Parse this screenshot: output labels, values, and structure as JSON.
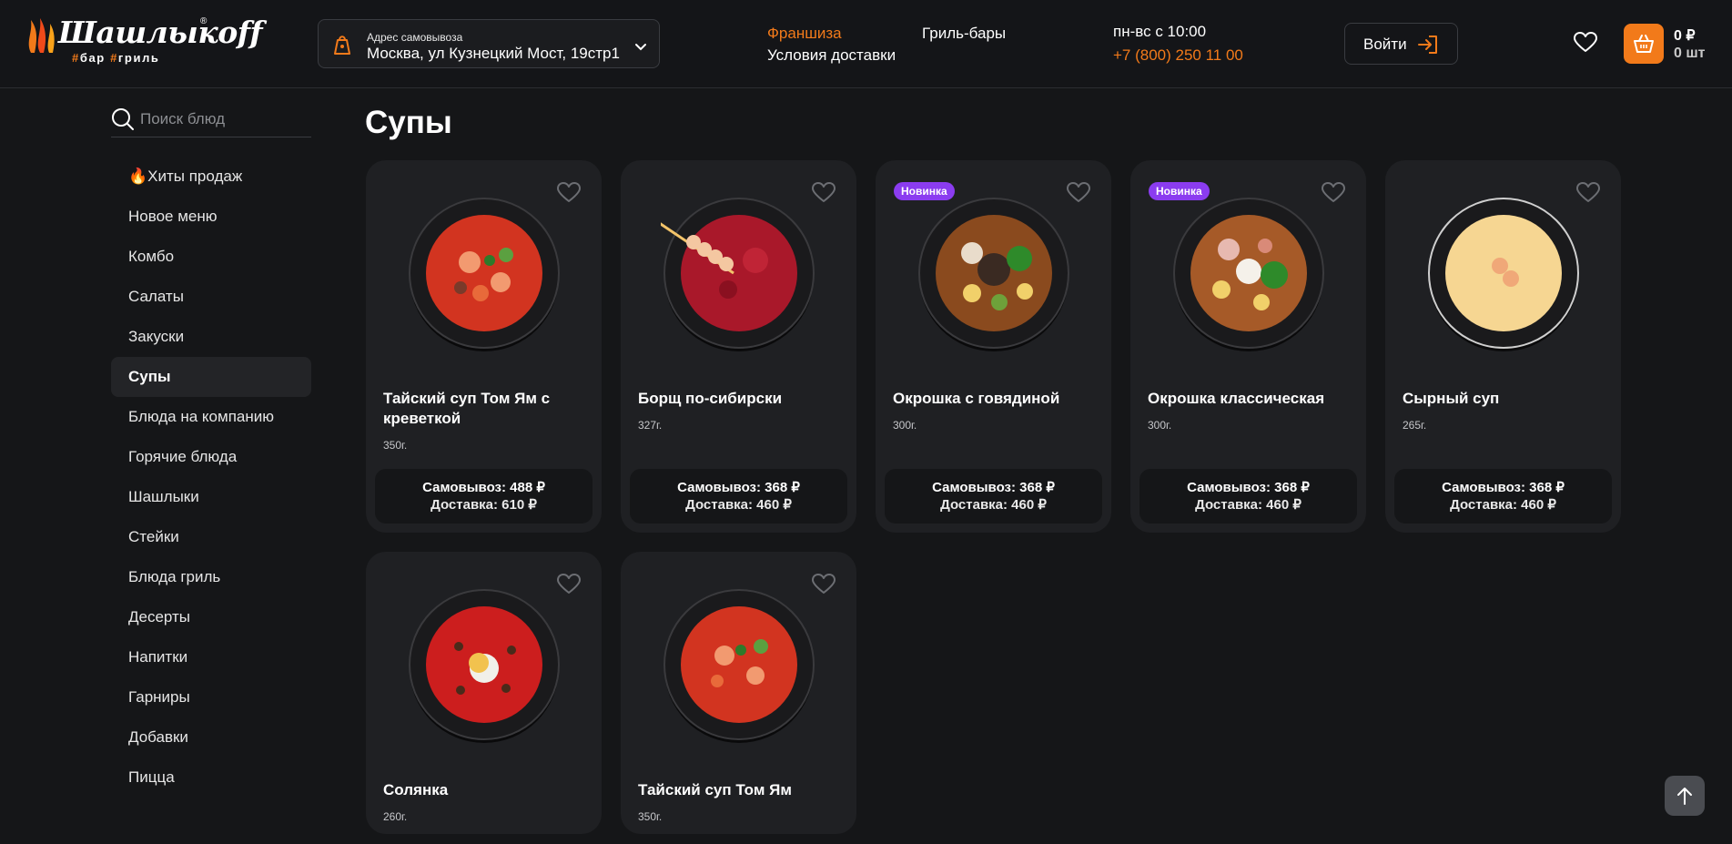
{
  "header": {
    "logo_text": "Шашлыкoff",
    "logo_sub_1": "бар",
    "logo_sub_2": "гриль",
    "address_label": "Адрес самовывоза",
    "address_value": "Москва, ул Кузнецкий Мост, 19стр1",
    "franchise": "Франшиза",
    "delivery_terms": "Условия доставки",
    "grill_bars": "Гриль-бары",
    "hours": "пн-вс с 10:00",
    "phone": "+7 (800) 250 11 00",
    "login": "Войти",
    "cart_sum": "0 ₽",
    "cart_count": "0 шт",
    "accent_color": "#f27a1a"
  },
  "sidebar": {
    "search_placeholder": "Поиск блюд",
    "items": [
      {
        "label": "🔥Хиты продаж"
      },
      {
        "label": "Новое меню"
      },
      {
        "label": "Комбо"
      },
      {
        "label": "Салаты"
      },
      {
        "label": "Закуски"
      },
      {
        "label": "Супы",
        "active": true
      },
      {
        "label": "Блюда на компанию"
      },
      {
        "label": "Горячие блюда"
      },
      {
        "label": "Шашлыки"
      },
      {
        "label": "Стейки"
      },
      {
        "label": "Блюда гриль"
      },
      {
        "label": "Десерты"
      },
      {
        "label": "Напитки"
      },
      {
        "label": "Гарниры"
      },
      {
        "label": "Добавки"
      },
      {
        "label": "Пицца"
      }
    ]
  },
  "main": {
    "title": "Супы",
    "badge_new": "Новинка",
    "products": [
      {
        "name": "Тайский суп Том Ям с креветкой",
        "weight": "350г.",
        "pickup": "Самовывоз: 488 ₽",
        "delivery": "Доставка: 610 ₽",
        "badge": false,
        "image": "tom-yum-shrimp-bowl"
      },
      {
        "name": "Борщ по-сибирски",
        "weight": "327г.",
        "pickup": "Самовывоз: 368 ₽",
        "delivery": "Доставка: 460 ₽",
        "badge": false,
        "image": "borscht-bowl"
      },
      {
        "name": "Окрошка с говядиной",
        "weight": "300г.",
        "pickup": "Самовывоз: 368 ₽",
        "delivery": "Доставка: 460 ₽",
        "badge": true,
        "image": "okroshka-beef-bowl"
      },
      {
        "name": "Окрошка классическая",
        "weight": "300г.",
        "pickup": "Самовывоз: 368 ₽",
        "delivery": "Доставка: 460 ₽",
        "badge": true,
        "image": "okroshka-classic-bowl"
      },
      {
        "name": "Сырный суп",
        "weight": "265г.",
        "pickup": "Самовывоз: 368 ₽",
        "delivery": "Доставка: 460 ₽",
        "badge": false,
        "image": "cheese-soup-bowl"
      },
      {
        "name": "Солянка",
        "weight": "260г.",
        "badge": false,
        "image": "solyanka-bowl"
      },
      {
        "name": "Тайский суп Том Ям",
        "weight": "350г.",
        "badge": false,
        "image": "tom-yum-bowl"
      }
    ]
  }
}
